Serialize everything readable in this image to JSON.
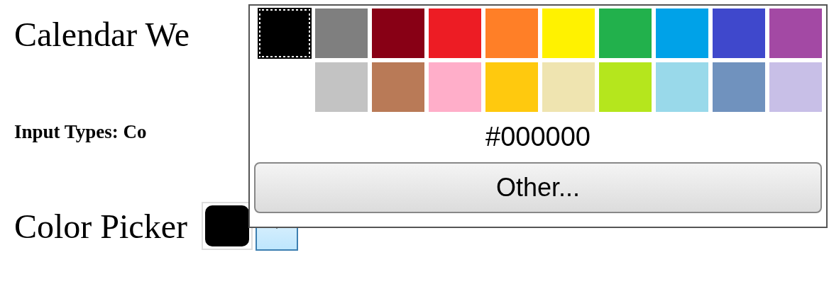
{
  "page_texts": [
    {
      "kind": "heading",
      "text": "Calendar We"
    },
    {
      "kind": "subheading",
      "text": "Input Types: Co"
    }
  ],
  "color_picker": {
    "label": "Color Picker",
    "color": "#000000",
    "dropdown_open": true
  },
  "palette": {
    "rows": [
      [
        {
          "color": "#000000",
          "selected": true
        },
        {
          "color": "#7f7f7f",
          "selected": false
        },
        {
          "color": "#880015",
          "selected": false
        },
        {
          "color": "#ed1c24",
          "selected": false
        },
        {
          "color": "#ff7f27",
          "selected": false
        },
        {
          "color": "#fff200",
          "selected": false
        },
        {
          "color": "#22b14c",
          "selected": false
        },
        {
          "color": "#00a2e8",
          "selected": false
        },
        {
          "color": "#3f48cc",
          "selected": false
        },
        {
          "color": "#a349a4",
          "selected": false
        }
      ],
      [
        {
          "color": "#c3c3c3",
          "selected": false
        },
        {
          "color": "#b97a57",
          "selected": false
        },
        {
          "color": "#ffaec9",
          "selected": false
        },
        {
          "color": "#ffc90e",
          "selected": false
        },
        {
          "color": "#efe4b0",
          "selected": false
        },
        {
          "color": "#b5e61d",
          "selected": false
        },
        {
          "color": "#99d9ea",
          "selected": false
        },
        {
          "color": "#7092be",
          "selected": false
        },
        {
          "color": "#c8bfe7",
          "selected": false
        }
      ]
    ],
    "hex": "#000000",
    "other_button": "Other..."
  }
}
